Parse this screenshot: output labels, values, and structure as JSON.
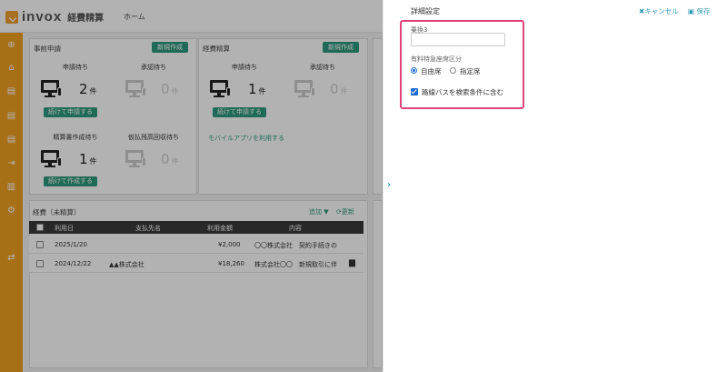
{
  "header": {
    "logo_text": "invox",
    "logo_sub": "経費精算",
    "nav_home": "ホーム"
  },
  "sidebar": {
    "icons": [
      "plus-circle-icon",
      "home-icon",
      "document-icon",
      "document-icon",
      "document-icon",
      "export-icon",
      "chart-icon",
      "gear-icon",
      "link-icon"
    ]
  },
  "pre_application": {
    "title": "事前申請",
    "new_button": "新規作成",
    "pending_label": "申請待ち",
    "pending_count": "2",
    "approval_label": "承認待ち",
    "approval_count": "0",
    "continue_button": "続けて申請する",
    "draft_label": "精算書作成待ち",
    "draft_count": "1",
    "advance_label": "仮払残高回収待ち",
    "advance_count": "0",
    "continue_create_button": "続けて作成する",
    "unit": "件"
  },
  "expense": {
    "title": "経費精算",
    "new_button": "新規作成",
    "pending_label": "申請待ち",
    "pending_count": "1",
    "approval_label": "承認待ち",
    "approval_count": "0",
    "continue_button": "続けて申請する",
    "mobile_link": "モバイルアプリを利用する",
    "unit": "件"
  },
  "unsettled": {
    "title": "経費（未精算）",
    "add_label": "追加",
    "refresh_label": "更新",
    "columns": [
      "利用日",
      "支払先名",
      "利用金額",
      "内容"
    ],
    "rows": [
      {
        "date": "2025/1/20",
        "payee": "",
        "amount": "¥2,000",
        "content": "〇〇株式会社　契約手続きの"
      },
      {
        "date": "2024/12/22",
        "payee": "▲▲株式会社",
        "amount": "¥18,260",
        "content": "株式会社〇〇　新規取引に伴"
      }
    ]
  },
  "drawer": {
    "title": "詳細設定",
    "cancel_label": "キャンセル",
    "save_label": "保存",
    "field_label": "乗換3",
    "field_value": "",
    "seat_section_label": "有料特急座席区分",
    "seat_options": [
      "自由席",
      "指定席"
    ],
    "seat_selected": "自由席",
    "bus_checkbox_label": "路線バスを検索条件に含む",
    "bus_checked": true
  },
  "colors": {
    "accent": "#f0a020",
    "teal": "#2e9a7e",
    "link": "#2e9ab8",
    "highlight": "#e0457a"
  }
}
